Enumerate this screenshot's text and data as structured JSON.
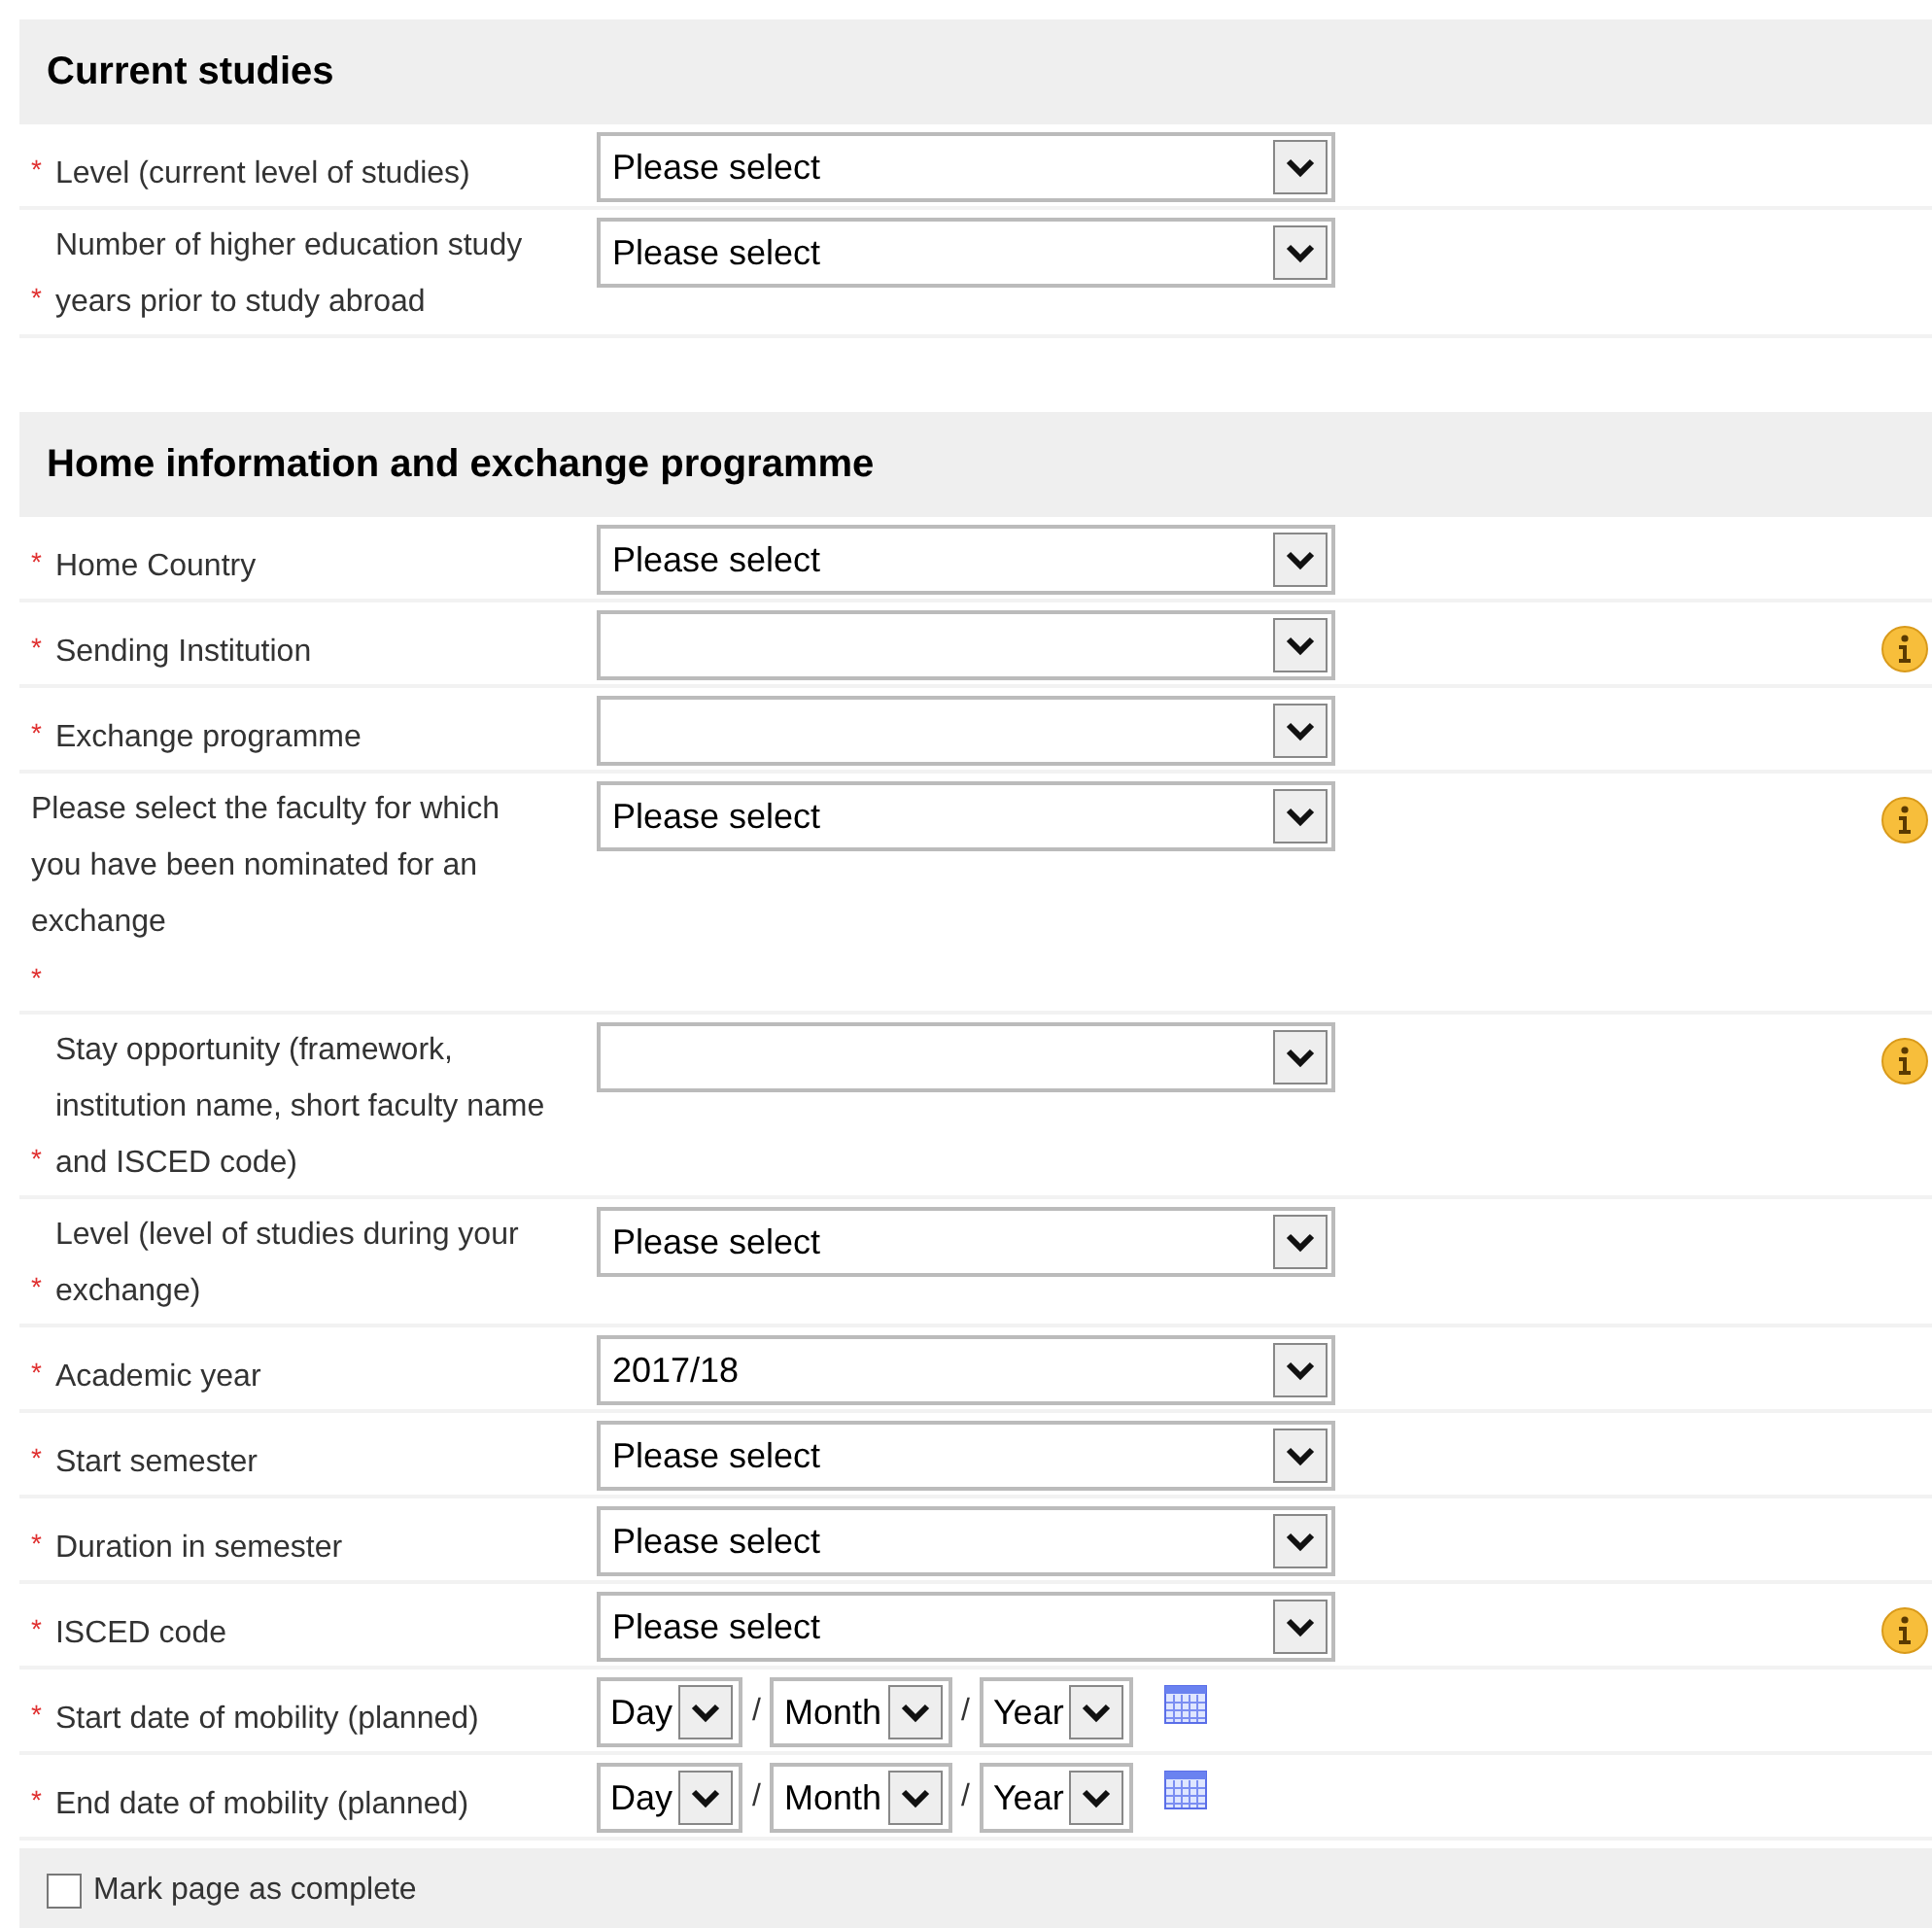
{
  "sections": [
    {
      "title": "Current studies",
      "fields": [
        {
          "kind": "select",
          "label_lines": [
            "Level (current level of studies)"
          ],
          "required_mark": "*",
          "value": "Please select",
          "info": false
        },
        {
          "kind": "select",
          "label_lines": [
            "Number of higher education study",
            "years prior to study abroad"
          ],
          "required_mark": "*",
          "value": "Please select",
          "info": false
        }
      ]
    },
    {
      "title": "Home information and exchange programme",
      "fields": [
        {
          "kind": "select",
          "label_lines": [
            "Home Country"
          ],
          "required_mark": "*",
          "value": "Please select",
          "info": false
        },
        {
          "kind": "select",
          "label_lines": [
            "Sending Institution"
          ],
          "required_mark": "*",
          "info": true
        },
        {
          "kind": "select",
          "label_lines": [
            "Exchange programme"
          ],
          "required_mark": "*",
          "info": false
        },
        {
          "kind": "select",
          "label_lines": [
            "Please select the faculty for which",
            "you have been nominated for an",
            "exchange"
          ],
          "required_mark": "*",
          "asterisk_own_line": true,
          "value": "Please select",
          "info": true
        },
        {
          "kind": "select",
          "label_lines": [
            "Stay opportunity (framework,",
            "institution name, short faculty name",
            "and ISCED code)"
          ],
          "required_mark": "*",
          "info": true
        },
        {
          "kind": "select",
          "label_lines": [
            "Level (level of studies during your",
            "exchange)"
          ],
          "required_mark": "*",
          "value": "Please select",
          "info": false
        },
        {
          "kind": "select",
          "label_lines": [
            "Academic year"
          ],
          "required_mark": "*",
          "value": "2017/18",
          "info": false
        },
        {
          "kind": "select",
          "label_lines": [
            "Start semester"
          ],
          "required_mark": "*",
          "value": "Please select",
          "info": false
        },
        {
          "kind": "select",
          "label_lines": [
            "Duration in semester"
          ],
          "required_mark": "*",
          "value": "Please select",
          "info": false
        },
        {
          "kind": "select",
          "label_lines": [
            "ISCED code"
          ],
          "required_mark": "*",
          "value": "Please select",
          "info": true
        },
        {
          "kind": "date",
          "label_lines": [
            "Start date of mobility (planned)"
          ],
          "required_mark": "*",
          "parts": [
            "Day",
            "Month",
            "Year"
          ],
          "separators": [
            "/",
            "/"
          ]
        },
        {
          "kind": "date",
          "label_lines": [
            "End date of mobility (planned)"
          ],
          "required_mark": "*",
          "parts": [
            "Day",
            "Month",
            "Year"
          ],
          "separators": [
            "/",
            "/"
          ]
        }
      ]
    }
  ],
  "footer": {
    "checkbox_label": "Mark page as complete",
    "checked": false
  }
}
